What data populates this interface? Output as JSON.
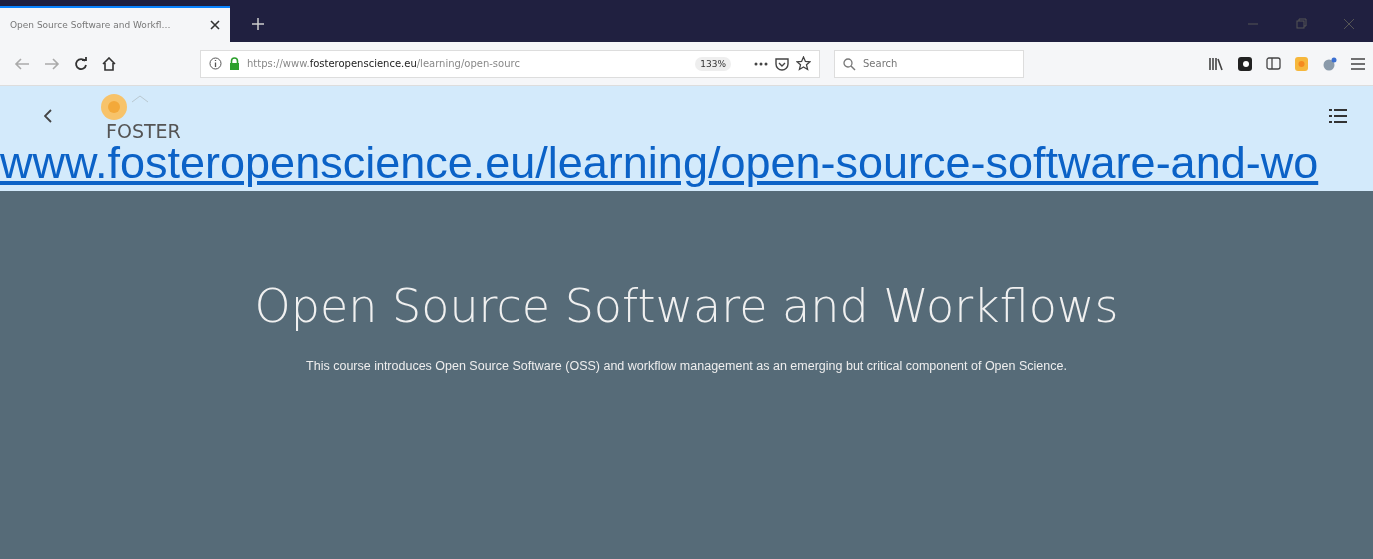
{
  "browser": {
    "tab": {
      "title": "Open Source Software and Workfl…",
      "selected": true
    },
    "url": {
      "prefix": "https://www.",
      "domain": "fosteropenscience.eu",
      "path": "/learning/open-sourc"
    },
    "zoom": "133%",
    "search": {
      "placeholder": "Search"
    }
  },
  "site_header": {
    "logo_text": "FOSTER"
  },
  "overlay_link": "www.fosteropenscience.eu/learning/open-source-software-and-wo",
  "hero": {
    "title": "Open Source Software and Workflows",
    "description": "This course introduces Open Source Software (OSS) and workflow management as an emerging but critical component of Open Science."
  }
}
